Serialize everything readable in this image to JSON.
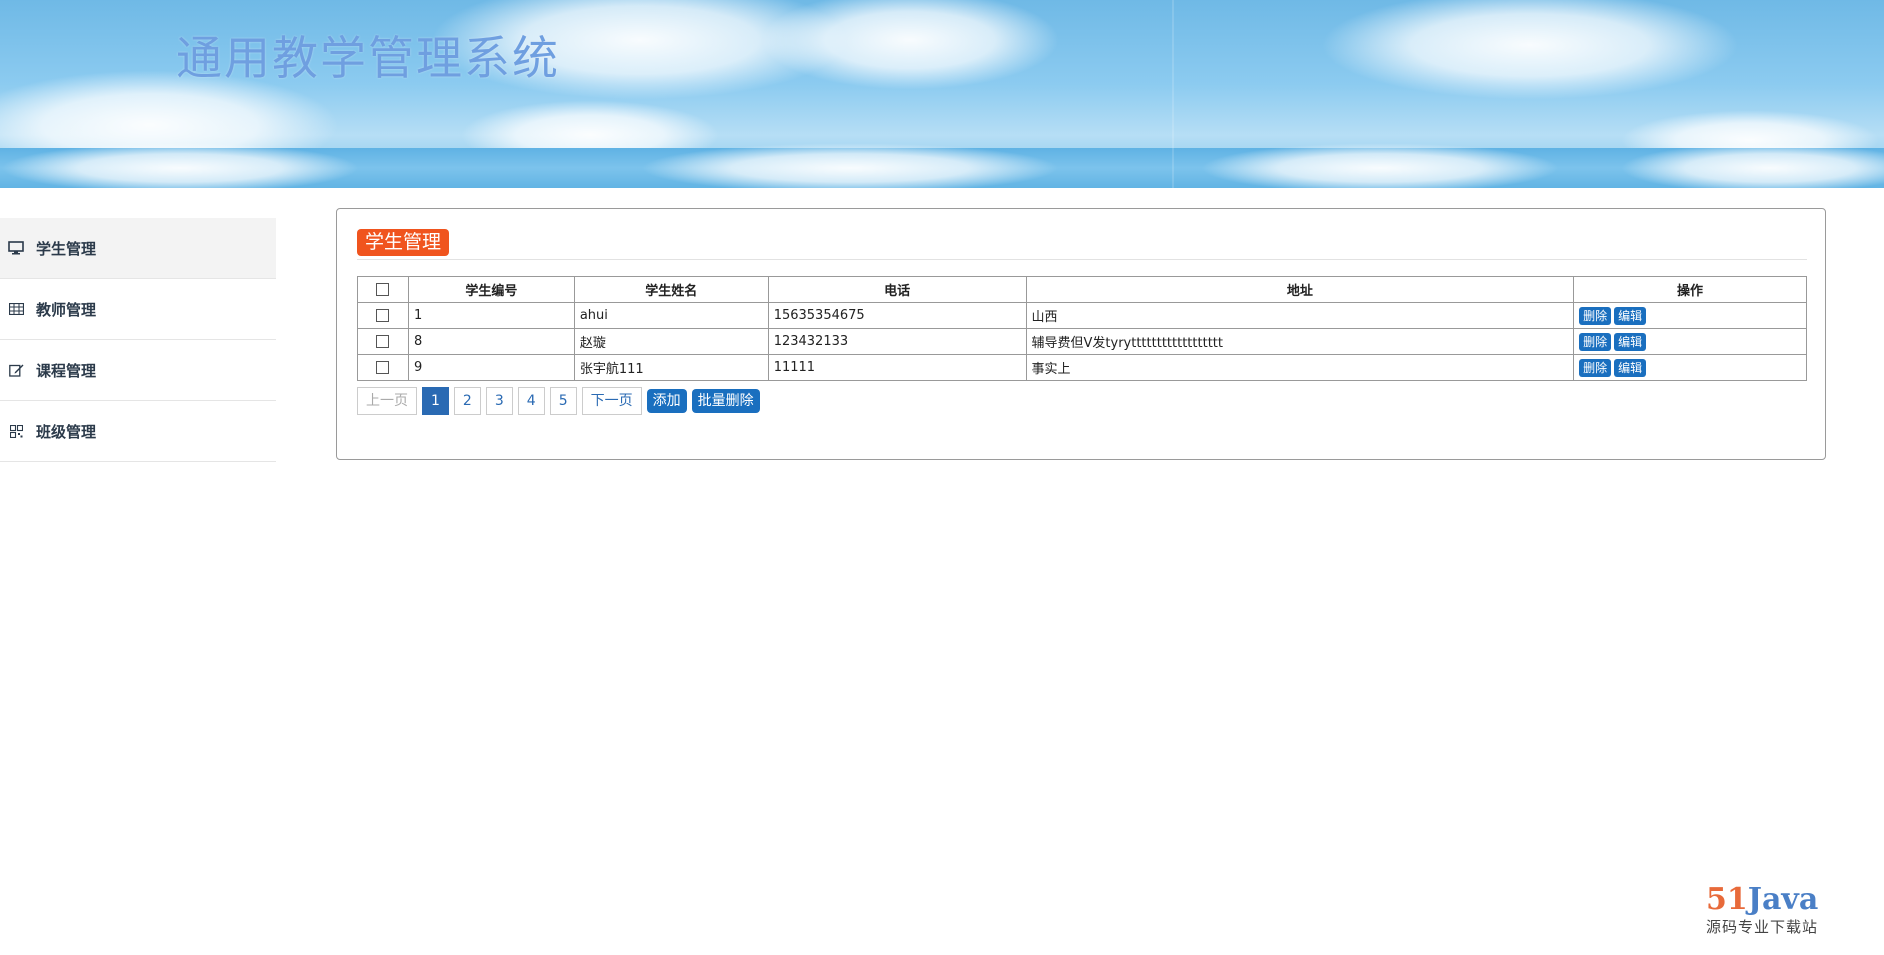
{
  "header": {
    "title": "通用教学管理系统"
  },
  "sidebar": {
    "items": [
      {
        "label": "学生管理",
        "icon": "monitor-icon"
      },
      {
        "label": "教师管理",
        "icon": "table-icon"
      },
      {
        "label": "课程管理",
        "icon": "edit-icon"
      },
      {
        "label": "班级管理",
        "icon": "qrcode-icon"
      }
    ]
  },
  "panel": {
    "title": "学生管理"
  },
  "table": {
    "columns": [
      "学生编号",
      "学生姓名",
      "电话",
      "地址",
      "操作"
    ],
    "rows": [
      {
        "id": "1",
        "name": "ahui",
        "phone": "15635354675",
        "address": "山西"
      },
      {
        "id": "8",
        "name": "赵璇",
        "phone": "123432133",
        "address": "辅导费但V发tyrytttttttttttttttttt"
      },
      {
        "id": "9",
        "name": "张宇航111",
        "phone": "11111",
        "address": "事实上"
      }
    ],
    "delete_label": "删除",
    "edit_label": "编辑"
  },
  "pager": {
    "prev_label": "上一页",
    "pages": [
      "1",
      "2",
      "3",
      "4",
      "5"
    ],
    "current": "1",
    "next_label": "下一页",
    "add_label": "添加",
    "batch_delete_label": "批量删除"
  },
  "watermark": {
    "logo_num": "51",
    "logo_word": "Java",
    "subtitle": "源码专业下载站"
  },
  "colors": {
    "accent_orange": "#f0541e",
    "button_blue": "#1a6fbf",
    "title_blue": "#6f9fe0"
  }
}
